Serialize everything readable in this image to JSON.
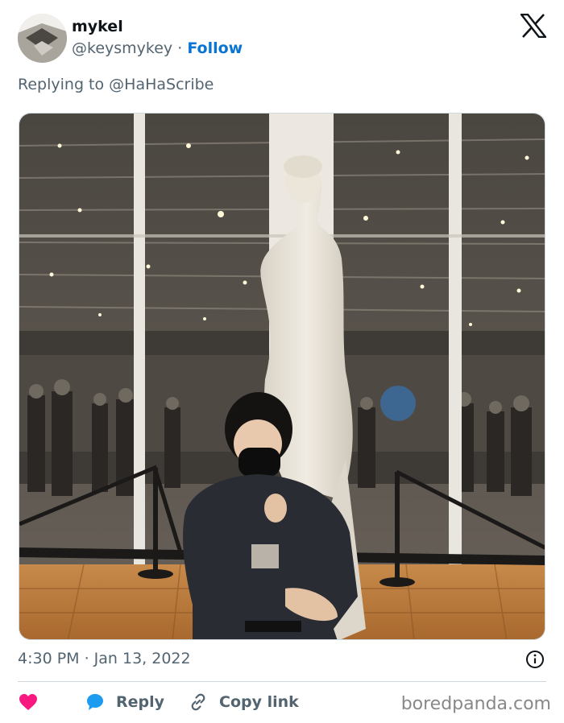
{
  "tweet": {
    "author": {
      "display_name": "mykel",
      "handle": "@keysmykey",
      "separator": "·",
      "follow_label": "Follow"
    },
    "replying_to": "Replying to @HaHaScribe",
    "timestamp": "4:30 PM · Jan 13, 2022",
    "actions": {
      "reply_label": "Reply",
      "copy_link_label": "Copy link"
    }
  },
  "watermark": "boredpanda.com",
  "colors": {
    "follow_blue": "#0a74d4",
    "heart_pink": "#f91880",
    "reply_blue": "#1d9bf0",
    "muted_gray": "#536471"
  },
  "icons": [
    "x-logo-icon",
    "info-icon",
    "heart-icon",
    "reply-bubble-icon",
    "link-icon"
  ]
}
